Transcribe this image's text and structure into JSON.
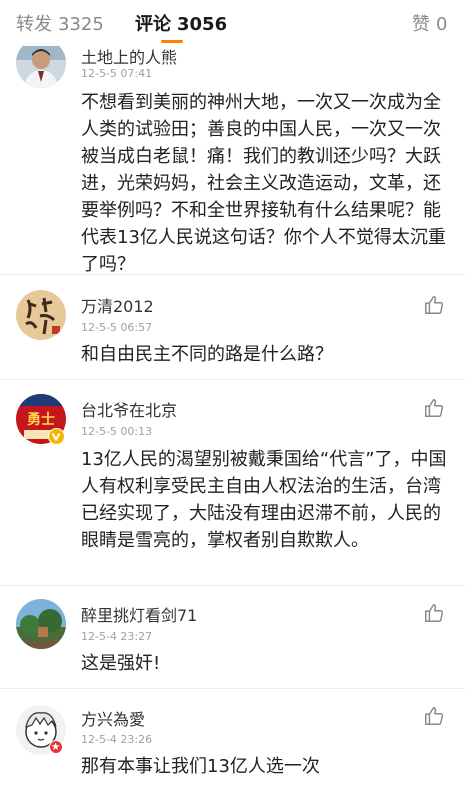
{
  "tabs": {
    "repost": {
      "label": "转发",
      "count": "3325"
    },
    "comments": {
      "label": "评论",
      "count": "3056"
    },
    "likes": {
      "label": "赞",
      "count": "0"
    }
  },
  "comments": [
    {
      "user": "土地上的人熊",
      "time": "12-5-5 07:41",
      "text": "不想看到美丽的神州大地，一次又一次成为全人类的试验田；善良的中国人民，一次又一次被当成白老鼠！痛！我们的教训还少吗？大跃进，光荣妈妈，社会主义改造运动，文革，还要举例吗？不和全世界接轨有什么结果呢？能代表13亿人民说这句话？你个人不觉得太沉重了吗？",
      "avatar": "man-portrait-avatar"
    },
    {
      "user": "万清2012",
      "time": "12-5-5 06:57",
      "text": "和自由民主不同的路是什么路？",
      "avatar": "calligraphy-avatar"
    },
    {
      "user": "台北爷在北京",
      "time": "12-5-5 00:13",
      "text": "13亿人民的渴望别被戴秉国给“代言”了，中国人有权利享受民主自由人权法治的生活，台湾已经实现了，大陆没有理由迟滞不前，人民的眼睛是雪亮的，掌权者别自欺欺人。",
      "avatar": "red-poster-avatar",
      "avatar_text": "勇士",
      "verified": true
    },
    {
      "user": "醉里挑灯看剑71",
      "time": "12-5-4 23:27",
      "text": "这是强奸!",
      "avatar": "landscape-avatar"
    },
    {
      "user": "方兴為愛",
      "time": "12-5-4 23:26",
      "text": "那有本事让我们13亿人选一次",
      "avatar": "cartoon-avatar"
    }
  ],
  "colors": {
    "accent": "#ff8200",
    "verified_badge": "#f7b500",
    "red_badge": "#e4393c"
  },
  "icons": {
    "like": "thumbs-up-icon",
    "verified": "verified-v-icon",
    "badge": "star-badge-icon"
  }
}
